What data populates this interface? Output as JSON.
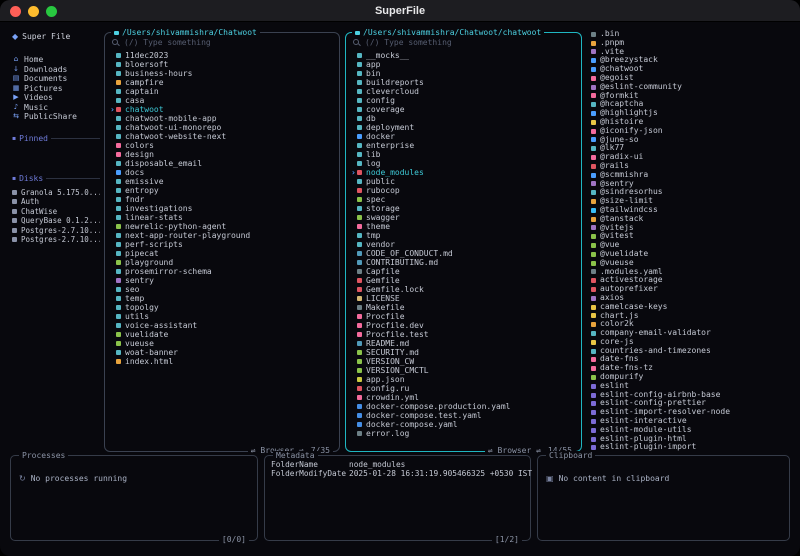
{
  "window": {
    "title": "SuperFile"
  },
  "cursor": "›",
  "sidebar": {
    "title": "Super File",
    "logo_glyph": "◆",
    "items": [
      {
        "g": "⌂",
        "label": "Home"
      },
      {
        "g": "↓",
        "label": "Downloads"
      },
      {
        "g": "▤",
        "label": "Documents"
      },
      {
        "g": "▦",
        "label": "Pictures"
      },
      {
        "g": "▶",
        "label": "Videos"
      },
      {
        "g": "♪",
        "label": "Music"
      },
      {
        "g": "⇆",
        "label": "PublicShare"
      }
    ],
    "pinned_title": "Pinned",
    "disks_title": "Disks",
    "disks": [
      {
        "n": "Granola 5.175.0..."
      },
      {
        "n": "Auth"
      },
      {
        "n": "ChatWise"
      },
      {
        "n": "QueryBase 0.1.2..."
      },
      {
        "n": "Postgres-2.7.10..."
      },
      {
        "n": "Postgres-2.7.10..."
      }
    ]
  },
  "panels": [
    {
      "path": "/Users/shivammishra/Chatwoot",
      "search_placeholder": "(/) Type something",
      "mode": "⇌ Browser ⇌",
      "counter": "7/35",
      "items": [
        {
          "n": "11dec2023",
          "c": "#56b6c2"
        },
        {
          "n": "bloersoft",
          "c": "#56b6c2"
        },
        {
          "n": "business-hours",
          "c": "#56b6c2"
        },
        {
          "n": "campfire",
          "c": "#e8a33d"
        },
        {
          "n": "captain",
          "c": "#56b6c2"
        },
        {
          "n": "casa",
          "c": "#56b6c2"
        },
        {
          "n": "chatwoot",
          "c": "#e05561",
          "sel": true
        },
        {
          "n": "chatwoot-mobile-app",
          "c": "#56b6c2"
        },
        {
          "n": "chatwoot-ui-monorepo",
          "c": "#56b6c2"
        },
        {
          "n": "chatwoot-website-next",
          "c": "#56b6c2"
        },
        {
          "n": "colors",
          "c": "#f56b9d"
        },
        {
          "n": "design",
          "c": "#f56b9d"
        },
        {
          "n": "disposable_email",
          "c": "#56b6c2"
        },
        {
          "n": "docs",
          "c": "#4a9eff"
        },
        {
          "n": "emissive",
          "c": "#56b6c2"
        },
        {
          "n": "entropy",
          "c": "#56b6c2"
        },
        {
          "n": "fndr",
          "c": "#56b6c2"
        },
        {
          "n": "investigations",
          "c": "#56b6c2"
        },
        {
          "n": "linear-stats",
          "c": "#56b6c2"
        },
        {
          "n": "newrelic-python-agent",
          "c": "#8bc34a"
        },
        {
          "n": "next-app-router-playground",
          "c": "#56b6c2"
        },
        {
          "n": "perf-scripts",
          "c": "#56b6c2"
        },
        {
          "n": "pipecat",
          "c": "#56b6c2"
        },
        {
          "n": "playground",
          "c": "#8bc34a"
        },
        {
          "n": "prosemirror-schema",
          "c": "#56b6c2"
        },
        {
          "n": "sentry",
          "c": "#a074c4"
        },
        {
          "n": "seo",
          "c": "#56b6c2"
        },
        {
          "n": "temp",
          "c": "#56b6c2"
        },
        {
          "n": "topolgy",
          "c": "#56b6c2"
        },
        {
          "n": "utils",
          "c": "#56b6c2"
        },
        {
          "n": "voice-assistant",
          "c": "#56b6c2"
        },
        {
          "n": "vuelidate",
          "c": "#8bc34a"
        },
        {
          "n": "vueuse",
          "c": "#8bc34a"
        },
        {
          "n": "woat-banner",
          "c": "#56b6c2"
        },
        {
          "n": "index.html",
          "c": "#e8a33d"
        }
      ]
    },
    {
      "path": "/Users/shivammishra/Chatwoot/chatwoot",
      "search_placeholder": "(/) Type something",
      "mode": "⇌ Browser ⇌",
      "counter": "14/55",
      "items": [
        {
          "n": "__mocks__",
          "c": "#56b6c2"
        },
        {
          "n": "app",
          "c": "#56b6c2"
        },
        {
          "n": "bin",
          "c": "#56b6c2"
        },
        {
          "n": "buildreports",
          "c": "#56b6c2"
        },
        {
          "n": "clevercloud",
          "c": "#56b6c2"
        },
        {
          "n": "config",
          "c": "#56b6c2"
        },
        {
          "n": "coverage",
          "c": "#56b6c2"
        },
        {
          "n": "db",
          "c": "#56b6c2"
        },
        {
          "n": "deployment",
          "c": "#56b6c2"
        },
        {
          "n": "docker",
          "c": "#4a9eff"
        },
        {
          "n": "enterprise",
          "c": "#56b6c2"
        },
        {
          "n": "lib",
          "c": "#56b6c2"
        },
        {
          "n": "log",
          "c": "#56b6c2"
        },
        {
          "n": "node_modules",
          "c": "#e05561",
          "sel": true
        },
        {
          "n": "public",
          "c": "#56b6c2"
        },
        {
          "n": "rubocop",
          "c": "#e05561"
        },
        {
          "n": "spec",
          "c": "#8bc34a"
        },
        {
          "n": "storage",
          "c": "#56b6c2"
        },
        {
          "n": "swagger",
          "c": "#8bc34a"
        },
        {
          "n": "theme",
          "c": "#f56b9d"
        },
        {
          "n": "tmp",
          "c": "#56b6c2"
        },
        {
          "n": "vendor",
          "c": "#56b6c2"
        },
        {
          "n": "CODE_OF_CONDUCT.md",
          "c": "#519aba"
        },
        {
          "n": "CONTRIBUTING.md",
          "c": "#519aba"
        },
        {
          "n": "Capfile",
          "c": "#6d8086"
        },
        {
          "n": "Gemfile",
          "c": "#e05561"
        },
        {
          "n": "Gemfile.lock",
          "c": "#e05561"
        },
        {
          "n": "LICENSE",
          "c": "#d5b874"
        },
        {
          "n": "Makefile",
          "c": "#6d8086"
        },
        {
          "n": "Procfile",
          "c": "#f56b9d"
        },
        {
          "n": "Procfile.dev",
          "c": "#f56b9d"
        },
        {
          "n": "Procfile.test",
          "c": "#f56b9d"
        },
        {
          "n": "README.md",
          "c": "#519aba"
        },
        {
          "n": "SECURITY.md",
          "c": "#8bc34a"
        },
        {
          "n": "VERSION_CW",
          "c": "#8bc34a"
        },
        {
          "n": "VERSION_CMCTL",
          "c": "#8bc34a"
        },
        {
          "n": "app.json",
          "c": "#cbcb41"
        },
        {
          "n": "config.ru",
          "c": "#e05561"
        },
        {
          "n": "crowdin.yml",
          "c": "#f56b9d"
        },
        {
          "n": "docker-compose.production.yaml",
          "c": "#458ee6"
        },
        {
          "n": "docker-compose.test.yaml",
          "c": "#458ee6"
        },
        {
          "n": "docker-compose.yaml",
          "c": "#458ee6"
        },
        {
          "n": "error.log",
          "c": "#6d8086"
        }
      ]
    }
  ],
  "preview": {
    "items": [
      {
        "n": ".bin",
        "c": "#6d8086"
      },
      {
        "n": ".pnpm",
        "c": "#e8a33d"
      },
      {
        "n": ".vite",
        "c": "#a074c4"
      },
      {
        "n": "@breezystack",
        "c": "#4a9eff"
      },
      {
        "n": "@chatwoot",
        "c": "#4a9eff"
      },
      {
        "n": "@egoist",
        "c": "#f56b9d"
      },
      {
        "n": "@eslint-community",
        "c": "#a074c4"
      },
      {
        "n": "@formkit",
        "c": "#f56b9d"
      },
      {
        "n": "@hcaptcha",
        "c": "#56b6c2"
      },
      {
        "n": "@highlightjs",
        "c": "#4a9eff"
      },
      {
        "n": "@histoire",
        "c": "#e8c545"
      },
      {
        "n": "@iconify-json",
        "c": "#f56b9d"
      },
      {
        "n": "@june-so",
        "c": "#4a9eff"
      },
      {
        "n": "@lk77",
        "c": "#56b6c2"
      },
      {
        "n": "@radix-ui",
        "c": "#f56b9d"
      },
      {
        "n": "@rails",
        "c": "#e05561"
      },
      {
        "n": "@scmmishra",
        "c": "#4a9eff"
      },
      {
        "n": "@sentry",
        "c": "#a074c4"
      },
      {
        "n": "@sindresorhus",
        "c": "#56b6c2"
      },
      {
        "n": "@size-limit",
        "c": "#e8a33d"
      },
      {
        "n": "@tailwindcss",
        "c": "#38bdf8"
      },
      {
        "n": "@tanstack",
        "c": "#e8a33d"
      },
      {
        "n": "@vitejs",
        "c": "#a074c4"
      },
      {
        "n": "@vitest",
        "c": "#8bc34a"
      },
      {
        "n": "@vue",
        "c": "#8bc34a"
      },
      {
        "n": "@vuelidate",
        "c": "#8bc34a"
      },
      {
        "n": "@vueuse",
        "c": "#8bc34a"
      },
      {
        "n": ".modules.yaml",
        "c": "#6d8086"
      },
      {
        "n": "activestorage",
        "c": "#e05561"
      },
      {
        "n": "autoprefixer",
        "c": "#e05561"
      },
      {
        "n": "axios",
        "c": "#a074c4"
      },
      {
        "n": "camelcase-keys",
        "c": "#e8c545"
      },
      {
        "n": "chart.js",
        "c": "#e8c545"
      },
      {
        "n": "color2k",
        "c": "#e8a33d"
      },
      {
        "n": "company-email-validator",
        "c": "#56b6c2"
      },
      {
        "n": "core-js",
        "c": "#e8c545"
      },
      {
        "n": "countries-and-timezones",
        "c": "#56b6c2"
      },
      {
        "n": "date-fns",
        "c": "#f56b9d"
      },
      {
        "n": "date-fns-tz",
        "c": "#f56b9d"
      },
      {
        "n": "dompurify",
        "c": "#8bc34a"
      },
      {
        "n": "eslint",
        "c": "#7c6bd6"
      },
      {
        "n": "eslint-config-airbnb-base",
        "c": "#7c6bd6"
      },
      {
        "n": "eslint-config-prettier",
        "c": "#7c6bd6"
      },
      {
        "n": "eslint-import-resolver-node",
        "c": "#7c6bd6"
      },
      {
        "n": "eslint-interactive",
        "c": "#7c6bd6"
      },
      {
        "n": "eslint-module-utils",
        "c": "#7c6bd6"
      },
      {
        "n": "eslint-plugin-html",
        "c": "#7c6bd6"
      },
      {
        "n": "eslint-plugin-import",
        "c": "#7c6bd6"
      }
    ]
  },
  "processes": {
    "title": "Processes",
    "icon": "↻",
    "empty": "No processes running",
    "counter": "[0/0]"
  },
  "metadata": {
    "title": "Metadata",
    "counter": "[1/2]",
    "rows": [
      {
        "k": "FolderName",
        "v": "node_modules"
      },
      {
        "k": "FolderModifyDate",
        "v": "2025-01-28 16:31:19.905466325 +0530 IST"
      }
    ]
  },
  "clipboard": {
    "title": "Clipboard",
    "icon": "▣",
    "empty": "No content in clipboard"
  }
}
